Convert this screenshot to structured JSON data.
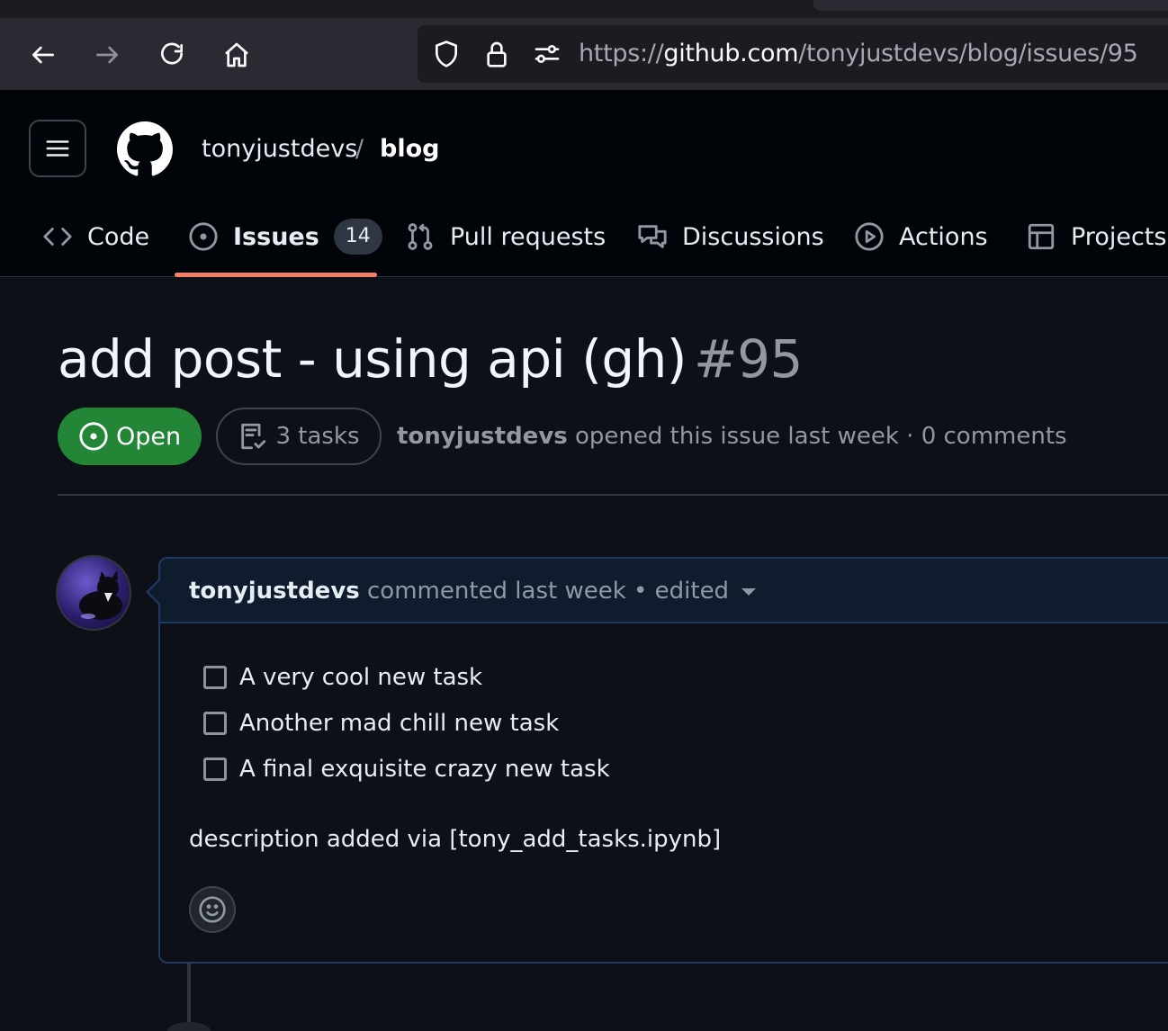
{
  "browser": {
    "url_scheme": "https://",
    "url_host": "github.com",
    "url_path": "/tonyjustdevs/blog/issues/95"
  },
  "repo": {
    "owner": "tonyjustdevs",
    "separator": "/",
    "name": "blog"
  },
  "nav": {
    "tabs": [
      {
        "label": "Code",
        "icon": "code-icon"
      },
      {
        "label": "Issues",
        "icon": "issue-opened-icon",
        "count": "14",
        "selected": true
      },
      {
        "label": "Pull requests",
        "icon": "git-pull-request-icon"
      },
      {
        "label": "Discussions",
        "icon": "comment-discussion-icon"
      },
      {
        "label": "Actions",
        "icon": "play-icon"
      },
      {
        "label": "Projects",
        "icon": "table-icon"
      }
    ]
  },
  "issue": {
    "title": "add post - using api (gh)",
    "number": "#95",
    "state": "Open",
    "tasks": "3 tasks",
    "author": "tonyjustdevs",
    "meta_rest": "opened this issue last week · 0 comments"
  },
  "comment": {
    "author": "tonyjustdevs",
    "meta_rest": "commented last week • edited",
    "tasks": [
      {
        "label": "A very cool new task",
        "checked": false
      },
      {
        "label": "Another mad chill new task",
        "checked": false
      },
      {
        "label": "A final exquisite crazy new task",
        "checked": false
      }
    ],
    "description": "description added via [tony_add_tasks.ipynb]"
  },
  "colors": {
    "accent_underline": "#f78166",
    "open_green": "#238636",
    "comment_border": "#1f3a66"
  }
}
